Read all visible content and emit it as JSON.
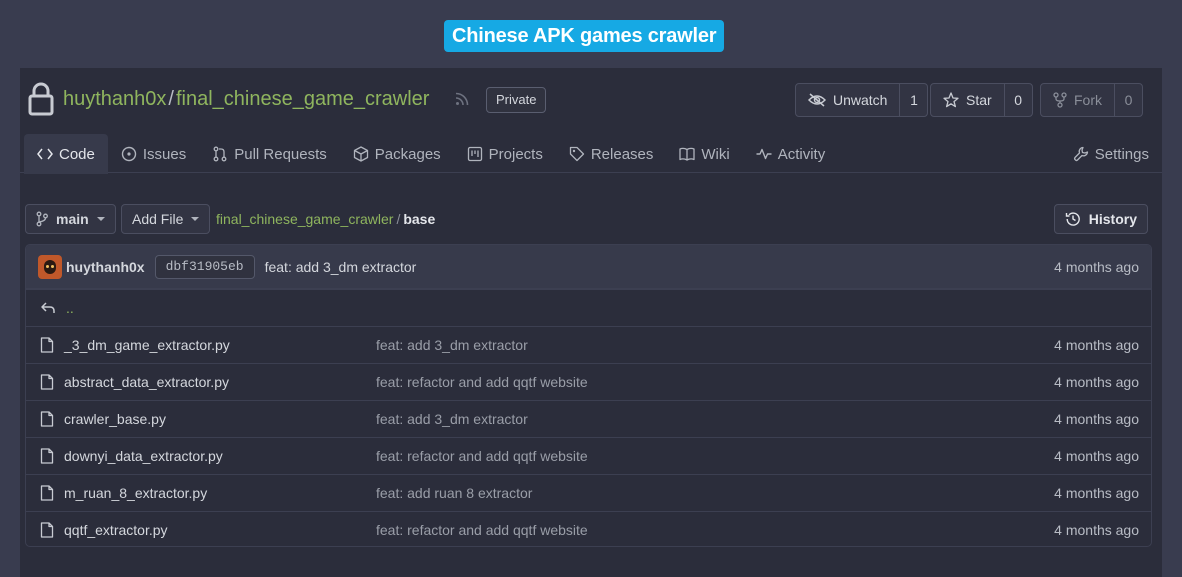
{
  "badge": "Chinese APK games crawler",
  "repo": {
    "owner": "huythanh0x",
    "separator": "/",
    "name": "final_chinese_game_crawler",
    "visibility": "Private"
  },
  "actions": {
    "watch_label": "Unwatch",
    "watch_count": "1",
    "star_label": "Star",
    "star_count": "0",
    "fork_label": "Fork",
    "fork_count": "0"
  },
  "tabs": [
    {
      "label": "Code",
      "icon": "code-icon",
      "active": true
    },
    {
      "label": "Issues",
      "icon": "issue-icon"
    },
    {
      "label": "Pull Requests",
      "icon": "pull-request-icon"
    },
    {
      "label": "Packages",
      "icon": "package-icon"
    },
    {
      "label": "Projects",
      "icon": "project-icon"
    },
    {
      "label": "Releases",
      "icon": "tag-icon"
    },
    {
      "label": "Wiki",
      "icon": "book-icon"
    },
    {
      "label": "Activity",
      "icon": "pulse-icon"
    }
  ],
  "settings_label": "Settings",
  "toolbar": {
    "branch": "main",
    "add_file": "Add File",
    "breadcrumb_repo": "final_chinese_game_crawler",
    "breadcrumb_sep": "/",
    "breadcrumb_dir": "base",
    "history": "History"
  },
  "latest_commit": {
    "author": "huythanh0x",
    "sha": "dbf31905eb",
    "message": "feat: add 3_dm extractor",
    "time": "4 months ago"
  },
  "up_label": "..",
  "files": [
    {
      "name": "_3_dm_game_extractor.py",
      "message": "feat: add 3_dm extractor",
      "time": "4 months ago"
    },
    {
      "name": "abstract_data_extractor.py",
      "message": "feat: refactor and add qqtf website",
      "time": "4 months ago"
    },
    {
      "name": "crawler_base.py",
      "message": "feat: add 3_dm extractor",
      "time": "4 months ago"
    },
    {
      "name": "downyi_data_extractor.py",
      "message": "feat: refactor and add qqtf website",
      "time": "4 months ago"
    },
    {
      "name": "m_ruan_8_extractor.py",
      "message": "feat: add ruan 8 extractor",
      "time": "4 months ago"
    },
    {
      "name": "qqtf_extractor.py",
      "message": "feat: refactor and add qqtf website",
      "time": "4 months ago"
    }
  ],
  "colors": {
    "accent_link": "#8fb55e",
    "badge_bg": "#16a9e4",
    "page_bg": "#393c4f",
    "panel_bg": "#2b2d3b"
  }
}
